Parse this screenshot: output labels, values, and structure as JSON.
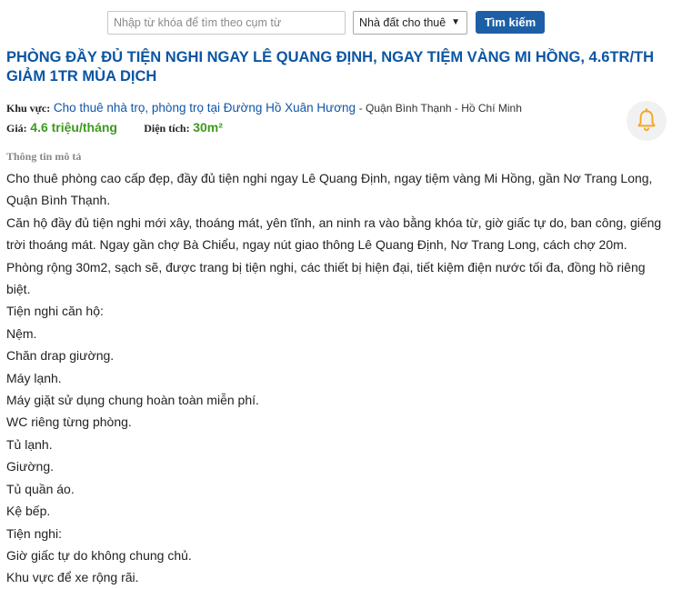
{
  "search": {
    "placeholder": "Nhập từ khóa để tìm theo cụm từ",
    "category_selected": "Nhà đất cho thuê",
    "button_label": "Tìm kiếm"
  },
  "listing": {
    "title": "PHÒNG ĐẦY ĐỦ TIỆN NGHI NGAY LÊ QUANG ĐỊNH, NGAY TIỆM VÀNG MI HỒNG, 4.6TR/TH GIẢM 1TR MÙA DỊCH",
    "area_label": "Khu vực:",
    "area_link": "Cho thuê nhà trọ, phòng trọ tại Đường Hồ Xuân Hương",
    "area_rest": "- Quận Bình Thạnh - Hồ Chí Minh",
    "price_label": "Giá:",
    "price_value": "4.6 triệu/tháng",
    "size_label": "Diện tích:",
    "size_value": "30m²",
    "section_label": "Thông tin mô tả",
    "description": [
      "Cho thuê phòng cao cấp đẹp, đầy đủ tiện nghi ngay Lê Quang Định, ngay tiệm vàng Mi Hồng, gần Nơ Trang Long, Quận Bình Thạnh.",
      "Căn hộ đầy đủ tiện nghi mới xây, thoáng mát, yên tĩnh, an ninh ra vào bằng khóa từ, giờ giấc tự do, ban công, giếng trời thoáng mát. Ngay gần chợ Bà Chiểu, ngay nút giao thông Lê Quang Định, Nơ Trang Long, cách chợ 20m.",
      "Phòng rộng 30m2, sạch sẽ, được trang bị tiện nghi, các thiết bị hiện đại, tiết kiệm điện nước tối đa, đồng hồ riêng biệt.",
      "Tiện nghi căn hộ:",
      "Nệm.",
      "Chăn drap giường.",
      "Máy lạnh.",
      "Máy giặt sử dụng chung hoàn toàn miễn phí.",
      "WC riêng từng phòng.",
      "Tủ lạnh.",
      "Giường.",
      "Tủ quần áo.",
      "Kệ bếp.",
      "Tiện nghi:",
      "Giờ giấc tự do không chung chủ.",
      "Khu vực để xe rộng rãi."
    ]
  },
  "colors": {
    "title": "#0b55a3",
    "button": "#1d5fa6",
    "price": "#3d9a1c",
    "bell": "#f5a623"
  },
  "icons": {
    "bell": "bell-icon",
    "dropdown": "chevron-down-icon"
  }
}
